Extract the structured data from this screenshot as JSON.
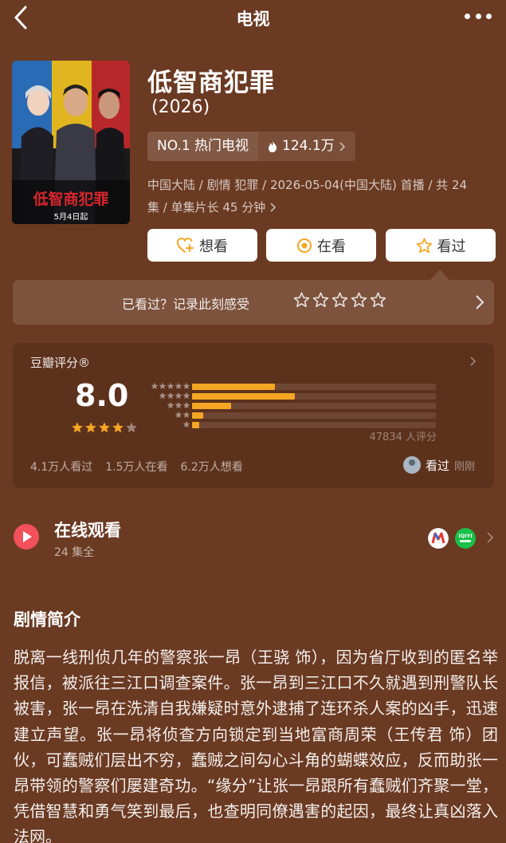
{
  "nav": {
    "title": "电视"
  },
  "header": {
    "title": "低智商犯罪",
    "year": "(2026)",
    "poster": {
      "title": "低智商犯罪",
      "date": "5月4日起"
    },
    "rank_label": "NO.1 热门电视",
    "heat": "124.1万",
    "meta_line1": "中国大陆 / 剧情 犯罪 / 2026-05-04(中国大陆) 首播 / 共 24",
    "meta_line2": "集 / 单集片长 45 分钟"
  },
  "actions": [
    {
      "label": "想看",
      "icon": "heart-plus-icon"
    },
    {
      "label": "在看",
      "icon": "target-icon"
    },
    {
      "label": "看过",
      "icon": "star-outline-icon"
    }
  ],
  "record": {
    "text": "已看过？记录此刻感受",
    "stars": 5
  },
  "rating": {
    "title": "豆瓣评分®",
    "score": "8.0",
    "stars_filled": 4,
    "distribution": [
      {
        "stars": 5,
        "fraction": 0.34
      },
      {
        "stars": 4,
        "fraction": 0.42
      },
      {
        "stars": 3,
        "fraction": 0.16
      },
      {
        "stars": 2,
        "fraction": 0.045
      },
      {
        "stars": 1,
        "fraction": 0.03
      }
    ],
    "count": "47834 人评分",
    "seen": "4.1万人看过",
    "watching": "1.5万人在看",
    "want": "6.2万人想看",
    "my_status": "看过",
    "my_time": "刚刚"
  },
  "watch": {
    "title": "在线观看",
    "subtitle": "24 集全",
    "platforms": [
      "mango-tv-icon",
      "iqiyi-icon"
    ],
    "iqiyi_label": "iQIYI"
  },
  "synopsis": {
    "title": "剧情简介",
    "text": "脱离一线刑侦几年的警察张一昂（王骁 饰），因为省厅收到的匿名举报信，被派往三江口调查案件。张一昂到三江口不久就遇到刑警队长被害，张一昂在洗清自我嫌疑时意外逮捕了连环杀人案的凶手，迅速建立声望。张一昂将侦查方向锁定到当地富商周荣（王传君 饰）团伙，可蠢贼们层出不穷，蠢贼之间勾心斗角的蝴蝶效应，反而助张一昂带领的警察们屡建奇功。“缘分”让张一昂跟所有蠢贼们齐聚一堂，凭借智慧和勇气笑到最后，也查明同僚遇害的起因，最终让真凶落入法网。"
  }
}
